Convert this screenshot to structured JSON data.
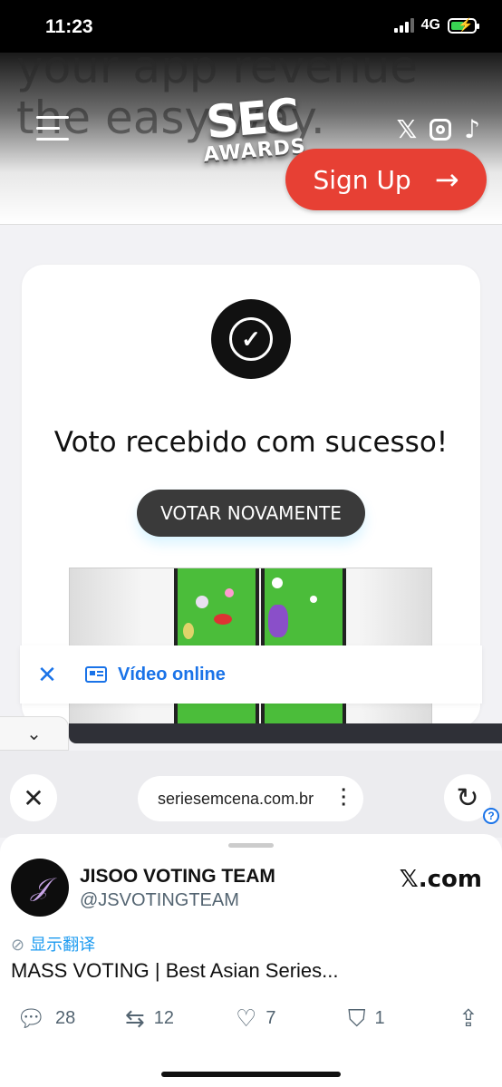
{
  "status_bar": {
    "time": "11:23",
    "network": "4G"
  },
  "site": {
    "background_text": [
      "your app revenue",
      "the easy way."
    ],
    "logo_line1": "SEC",
    "logo_line2": "AWARDS",
    "social_icons": [
      "x-icon",
      "instagram-icon",
      "tiktok-icon"
    ],
    "signup_label": "Sign Up",
    "accent_color": "#e74034"
  },
  "vote": {
    "message": "Voto recebido com sucesso!",
    "again_label": "VOTAR NOVAMENTE"
  },
  "video_banner": {
    "label": "Vídeo online"
  },
  "browser": {
    "url": "seriesemcena.com.br"
  },
  "tweet": {
    "author_name": "JISOO VOTING TEAM",
    "author_handle": "@JSVOTINGTEAM",
    "source": "𝕏.com",
    "translate_label": "显示翻译",
    "text": "MASS VOTING | Best Asian Series...",
    "replies": "28",
    "retweets": "12",
    "likes": "7",
    "bookmarks": "1"
  }
}
